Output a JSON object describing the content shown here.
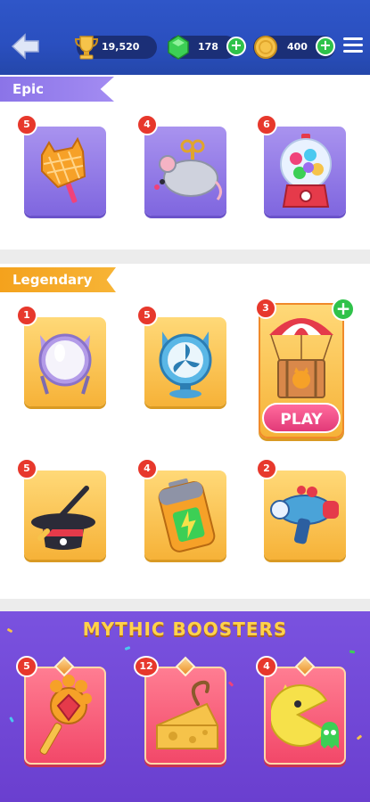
{
  "header": {
    "back_icon": "back-arrow-icon",
    "trophies": "19,520",
    "gems": "178",
    "coins": "400",
    "menu_icon": "hamburger-menu-icon"
  },
  "epic": {
    "label": "Epic",
    "items": [
      {
        "count": "5",
        "icon": "fly-swatter-icon"
      },
      {
        "count": "4",
        "icon": "windup-mouse-icon"
      },
      {
        "count": "6",
        "icon": "gumball-machine-icon"
      }
    ]
  },
  "legendary": {
    "label": "Legendary",
    "items": [
      {
        "count": "1",
        "icon": "cat-mirror-icon"
      },
      {
        "count": "5",
        "icon": "cat-fan-icon"
      },
      {
        "count": "3",
        "icon": "parachute-cat-crate-icon",
        "button": "PLAY"
      },
      {
        "count": "5",
        "icon": "magic-hat-icon"
      },
      {
        "count": "4",
        "icon": "battery-icon"
      },
      {
        "count": "2",
        "icon": "ray-gun-icon"
      }
    ]
  },
  "mythic": {
    "title": "MYTHIC BOOSTERS",
    "items": [
      {
        "count": "5",
        "icon": "paw-wand-icon"
      },
      {
        "count": "12",
        "icon": "cheese-mouse-icon"
      },
      {
        "count": "4",
        "icon": "pacman-cat-icon"
      }
    ]
  },
  "colors": {
    "topbar": "#2f56c8",
    "epic": "#8b74e8",
    "legendary": "#f4a21d",
    "mythic": "#6a3fcf",
    "badge": "#e7382c",
    "play": "#e23a78"
  }
}
